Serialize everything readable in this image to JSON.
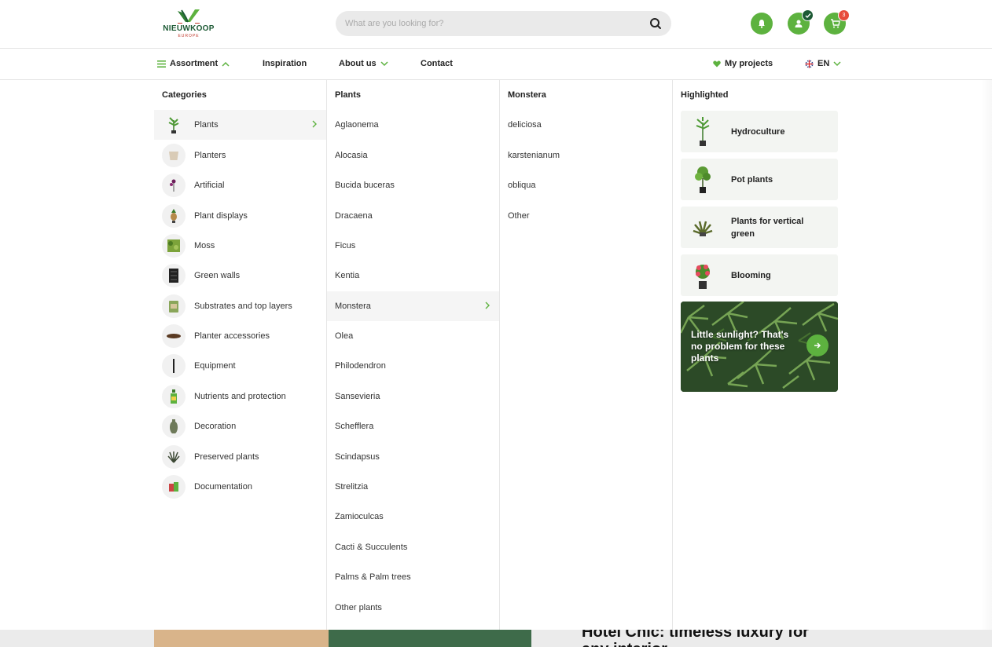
{
  "header": {
    "logo_text": "NIEUWKOOP",
    "logo_sub": "EUROPE",
    "search_placeholder": "What are you looking for?",
    "cart_count": "3",
    "brand_color": "#5db23f"
  },
  "nav": {
    "assortment": "Assortment",
    "inspiration": "Inspiration",
    "about": "About us",
    "contact": "Contact",
    "projects": "My projects",
    "language": "EN"
  },
  "categories": {
    "title": "Categories",
    "items": [
      {
        "label": "Plants",
        "icon": "plant-icon"
      },
      {
        "label": "Planters",
        "icon": "planter-icon"
      },
      {
        "label": "Artificial",
        "icon": "artificial-flower-icon"
      },
      {
        "label": "Plant displays",
        "icon": "plant-display-icon"
      },
      {
        "label": "Moss",
        "icon": "moss-icon"
      },
      {
        "label": "Green walls",
        "icon": "green-wall-icon"
      },
      {
        "label": "Substrates and top layers",
        "icon": "substrate-icon"
      },
      {
        "label": "Planter accessories",
        "icon": "saucer-icon"
      },
      {
        "label": "Equipment",
        "icon": "tool-icon"
      },
      {
        "label": "Nutrients and protection",
        "icon": "spray-bottle-icon"
      },
      {
        "label": "Decoration",
        "icon": "vase-icon"
      },
      {
        "label": "Preserved plants",
        "icon": "preserved-plant-icon"
      },
      {
        "label": "Documentation",
        "icon": "documentation-icon"
      }
    ]
  },
  "plants": {
    "title": "Plants",
    "items": [
      "Aglaonema",
      "Alocasia",
      "Bucida buceras",
      "Dracaena",
      "Ficus",
      "Kentia",
      "Monstera",
      "Olea",
      "Philodendron",
      "Sansevieria",
      "Schefflera",
      "Scindapsus",
      "Strelitzia",
      "Zamioculcas",
      "Cacti & Succulents",
      "Palms & Palm trees",
      "Other plants"
    ]
  },
  "monstera": {
    "title": "Monstera",
    "items": [
      "deliciosa",
      "karstenianum",
      "obliqua",
      "Other"
    ]
  },
  "highlighted": {
    "title": "Highlighted",
    "items": [
      {
        "label": "Hydroculture"
      },
      {
        "label": "Pot plants"
      },
      {
        "label": "Plants for vertical green"
      },
      {
        "label": "Blooming"
      }
    ],
    "promo_text": "Little sunlight? That's no problem for these plants"
  },
  "page": {
    "hero_title": "Hotel Chic: timeless luxury for any interior"
  }
}
